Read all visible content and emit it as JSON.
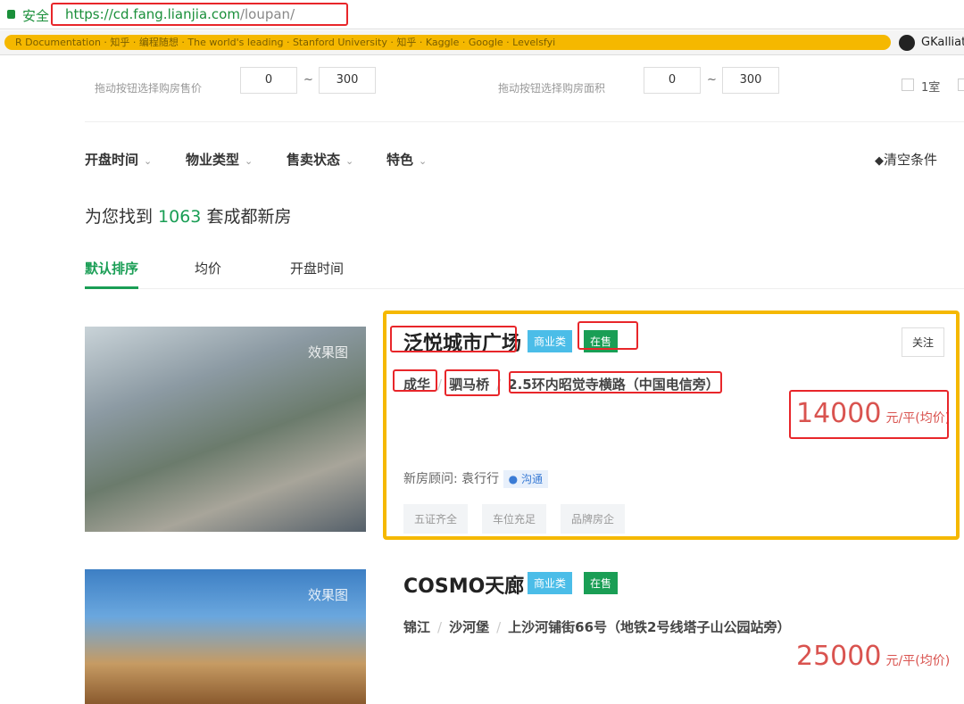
{
  "browser": {
    "secure_label": "安全",
    "url_host": "https://cd.fang.lianjia.com",
    "url_path": "/loupan/",
    "bookmarks_text": "R  Documentation  ·  知乎  ·  编程随想  ·  The world's leading  ·  Stanford University  ·  知乎  ·  Kaggle  ·  Google  ·  Levelsfyi",
    "github_label": "GKalliat"
  },
  "filters": {
    "price_label": "拖动按钮选择购房售价",
    "price_min": "0",
    "price_max": "300",
    "area_label": "拖动按钮选择购房面积",
    "area_min": "0",
    "area_max": "300",
    "tilde": "~",
    "room_option": "1室"
  },
  "dropdowns": [
    {
      "label": "开盘时间"
    },
    {
      "label": "物业类型"
    },
    {
      "label": "售卖状态"
    },
    {
      "label": "特色"
    }
  ],
  "dropdown_arrow": "⌄",
  "clear_label": "清空条件",
  "results": {
    "prefix": "为您找到 ",
    "count": "1063",
    "suffix": " 套成都新房"
  },
  "tabs": [
    {
      "label": "默认排序"
    },
    {
      "label": "均价"
    },
    {
      "label": "开盘时间"
    }
  ],
  "listings": [
    {
      "name": "泛悦城市广场",
      "type_tag": "商业类",
      "status_tag": "在售",
      "district": "成华",
      "area": "驷马桥",
      "address": "2.5环内昭觉寺横路（中国电信旁）",
      "price": "14000",
      "price_unit": "元/平(均价)",
      "follow": "关注",
      "advisor_label": "新房顾问:",
      "advisor": "袁行行",
      "chat": "沟通",
      "features": [
        "五证齐全",
        "车位充足",
        "品牌房企"
      ],
      "image_label": "效果图"
    },
    {
      "name": "COSMO天廊",
      "type_tag": "商业类",
      "status_tag": "在售",
      "district": "锦江",
      "area": "沙河堡",
      "address": "上沙河铺街66号（地铁2号线塔子山公园站旁）",
      "price": "25000",
      "price_unit": "元/平(均价)",
      "image_label": "效果图"
    }
  ],
  "sep": "/",
  "colors": {
    "green": "#1a9e55",
    "price_red": "#d9534f",
    "highlight_yellow": "#f5b800",
    "annot_red": "#e8262a"
  }
}
